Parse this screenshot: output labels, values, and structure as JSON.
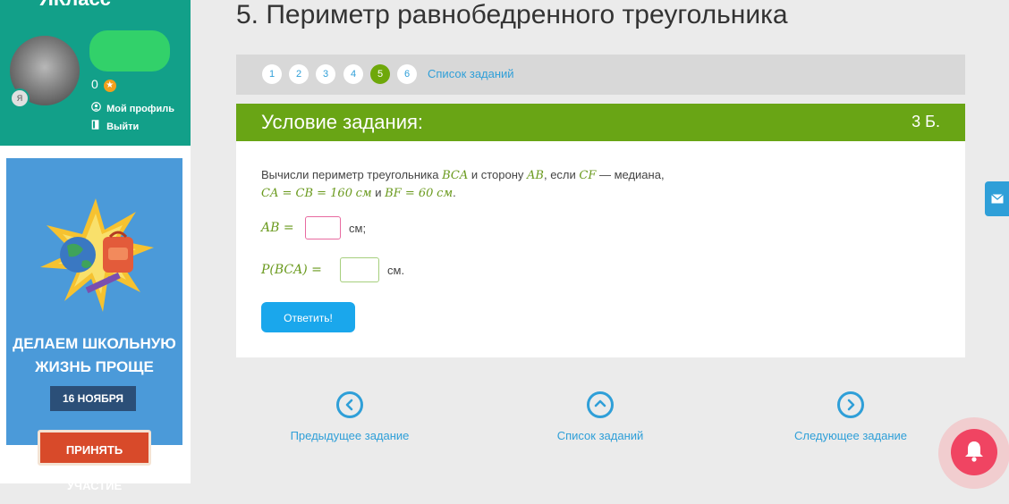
{
  "sidebar": {
    "logo_text": "ЯКласс",
    "points": "0",
    "star_glyph": "★",
    "links": [
      {
        "label": "Мой профиль",
        "icon": "user-circle-icon"
      },
      {
        "label": "Выйти",
        "icon": "exit-door-icon"
      }
    ],
    "banner": {
      "headline_1": "ДЕЛАЕМ ШКОЛЬНУЮ",
      "headline_2": "ЖИЗНЬ ПРОЩЕ",
      "date": "16 НОЯБРЯ",
      "button": "ПРИНЯТЬ УЧАСТИЕ"
    }
  },
  "page_title": "5. Периметр равнобедренного треугольника",
  "task_nav": {
    "numbers": [
      "1",
      "2",
      "3",
      "4",
      "5",
      "6"
    ],
    "active_index": 4,
    "list_link": "Список заданий"
  },
  "task": {
    "header": "Условие задания:",
    "points": "3 Б.",
    "condition": {
      "t1": "Вычисли периметр треугольника ",
      "m1": "BCA",
      "t2": " и сторону ",
      "m2": "AB",
      "t3": ", если ",
      "m3": "CF",
      "t4": " — медиана,",
      "m4": "CA = CB = 160",
      "m5": "см",
      "t5": " и ",
      "m6": "BF = 60",
      "m7": "см",
      "t6": "."
    },
    "answers": [
      {
        "label": "AB =",
        "value": "",
        "unit": "см;"
      },
      {
        "label": "P(BCA) =",
        "value": "",
        "unit": "см."
      }
    ],
    "submit": "Ответить!"
  },
  "bottom_nav": {
    "prev": "Предыдущее задание",
    "list": "Список заданий",
    "next": "Следующее задание"
  },
  "colors": {
    "sidebar": "#12a089",
    "accent_green": "#69a515",
    "link_blue": "#2f9fd8",
    "button_blue": "#1aa7ec",
    "bell_red": "#f04462"
  }
}
